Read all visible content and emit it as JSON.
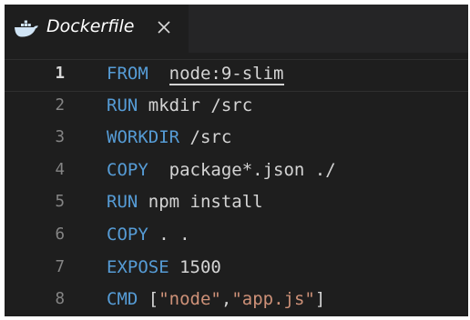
{
  "tab": {
    "icon": "docker-whale-icon",
    "title": "Dockerfile",
    "close_icon": "close-icon"
  },
  "editor": {
    "active_line": 1,
    "lines": [
      {
        "number": "1",
        "keyword": "FROM",
        "gap": "  ",
        "arg": "node:9-slim"
      },
      {
        "number": "2",
        "keyword": "RUN",
        "gap": " ",
        "arg": "mkdir /src"
      },
      {
        "number": "3",
        "keyword": "WORKDIR",
        "gap": " ",
        "arg": "/src"
      },
      {
        "number": "4",
        "keyword": "COPY",
        "gap": "  ",
        "arg": "package*.json ./"
      },
      {
        "number": "5",
        "keyword": "RUN",
        "gap": " ",
        "arg": "npm install"
      },
      {
        "number": "6",
        "keyword": "COPY",
        "gap": " ",
        "arg": ". ."
      },
      {
        "number": "7",
        "keyword": "EXPOSE",
        "gap": " ",
        "arg": "1500"
      },
      {
        "number": "8",
        "keyword": "CMD",
        "gap": " ",
        "arg_parts": [
          {
            "text": "[",
            "kind": "plain"
          },
          {
            "text": "\"node\"",
            "kind": "str"
          },
          {
            "text": ",",
            "kind": "plain"
          },
          {
            "text": "\"app.js\"",
            "kind": "str"
          },
          {
            "text": "]",
            "kind": "plain"
          }
        ]
      }
    ]
  },
  "colors": {
    "keyword": "#569cd6",
    "string": "#ce9178",
    "text": "#d4d4d4",
    "line_number": "#858585",
    "background": "#1e1e1e"
  }
}
